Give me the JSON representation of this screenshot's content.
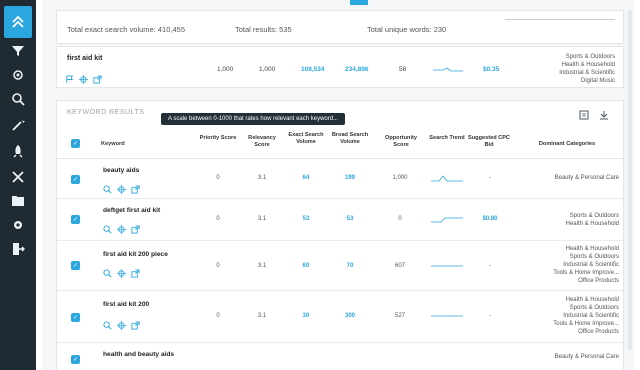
{
  "stats": {
    "volume": "Total exact search volume: 410,455",
    "results": "Total results: 535",
    "unique": "Total unique words: 230"
  },
  "seed": {
    "keyword": "first aid kit",
    "priority": "1,000",
    "relevancy": "1,000",
    "exact": "108,534",
    "broad": "234,896",
    "opportunity": "58",
    "cpc": "$0.35",
    "categories": [
      "Sports & Outdoors",
      "Health & Household",
      "Industrial & Scientific",
      "Digital Music"
    ]
  },
  "results": {
    "title": "KEYWORD RESULTS",
    "tooltip": "A scale between 0-1000 that rates how relevant each keyword...",
    "headers": {
      "keyword": "Keyword",
      "priority": "Priority Score",
      "relevancy": "Relevancy Score",
      "exact": "Exact Search Volume",
      "broad": "Broad Search Volume",
      "opportunity": "Opportunity Score",
      "trend": "Search Trend",
      "cpc": "Suggested CPC Bid",
      "categories": "Dominant Categories"
    },
    "rows": [
      {
        "keyword": "beauty aids",
        "priority": "0",
        "relevancy": "3.1",
        "exact": "64",
        "broad": "199",
        "opportunity": "1,000",
        "cpc": "-",
        "categories": [
          "Beauty & Personal Care"
        ]
      },
      {
        "keyword": "deftget first aid kit",
        "priority": "0",
        "relevancy": "3.1",
        "exact": "53",
        "broad": "53",
        "opportunity": "0",
        "cpc": "$0.80",
        "categories": [
          "Sports & Outdoors",
          "Health & Household"
        ]
      },
      {
        "keyword": "first aid kit 200 piece",
        "priority": "0",
        "relevancy": "3.1",
        "exact": "60",
        "broad": "70",
        "opportunity": "607",
        "cpc": "-",
        "categories": [
          "Health & Household",
          "Sports & Outdoors",
          "Industrial & Scientific",
          "Tools & Home Improve...",
          "Office Products"
        ]
      },
      {
        "keyword": "first aid kit 200",
        "priority": "0",
        "relevancy": "3.1",
        "exact": "30",
        "broad": "300",
        "opportunity": "527",
        "cpc": "-",
        "categories": [
          "Health & Household",
          "Sports & Outdoors",
          "Industrial & Scientific",
          "Tools & Home Improve...",
          "Office Products"
        ]
      },
      {
        "keyword": "health and beauty aids",
        "priority": "",
        "relevancy": "",
        "exact": "",
        "broad": "",
        "opportunity": "",
        "cpc": "",
        "categories": [
          "Beauty & Personal Care"
        ]
      }
    ]
  }
}
